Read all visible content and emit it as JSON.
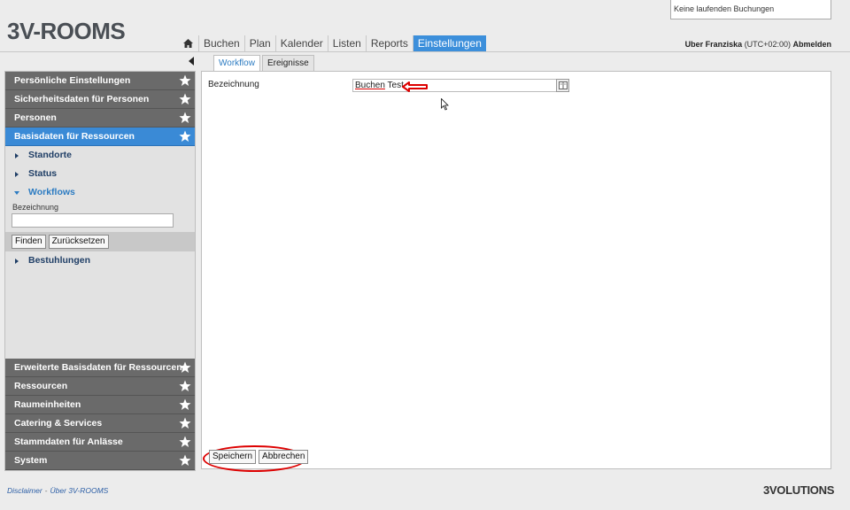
{
  "app": {
    "logo": "3V-ROOMS"
  },
  "notification": "Keine laufenden Buchungen",
  "topnav": {
    "home_icon": "home-icon",
    "tabs": [
      {
        "label": "Buchen"
      },
      {
        "label": "Plan"
      },
      {
        "label": "Kalender"
      },
      {
        "label": "Listen"
      },
      {
        "label": "Reports"
      },
      {
        "label": "Einstellungen",
        "active": true
      }
    ]
  },
  "user": {
    "name": "Uber Franziska",
    "tz": "(UTC+02:00)",
    "logout": "Abmelden"
  },
  "sidebar": {
    "sections_top": [
      {
        "label": "Persönliche Einstellungen"
      },
      {
        "label": "Sicherheitsdaten für Personen"
      },
      {
        "label": "Personen"
      },
      {
        "label": "Basisdaten für Ressourcen",
        "active": true
      }
    ],
    "subitems": [
      {
        "label": "Standorte"
      },
      {
        "label": "Status"
      },
      {
        "label": "Workflows",
        "open": true
      }
    ],
    "filter": {
      "label": "Bezeichnung",
      "value": "",
      "find": "Finden",
      "reset": "Zurücksetzen"
    },
    "subitem_after": {
      "label": "Bestuhlungen"
    },
    "sections_bottom": [
      {
        "label": "Erweiterte Basisdaten für Ressourcen"
      },
      {
        "label": "Ressourcen"
      },
      {
        "label": "Raumeinheiten"
      },
      {
        "label": "Catering & Services"
      },
      {
        "label": "Stammdaten für Anlässe"
      },
      {
        "label": "System"
      }
    ]
  },
  "main": {
    "tabs": [
      {
        "label": "Workflow",
        "active": true
      },
      {
        "label": "Ereignisse"
      }
    ],
    "field": {
      "label": "Bezeichnung",
      "value_part1": "Buchen",
      "value_part2": " Test"
    },
    "save": "Speichern",
    "cancel": "Abbrechen"
  },
  "footer": {
    "disclaimer": "Disclaimer",
    "about": "Über 3V-ROOMS",
    "brand": "3VOLUTIONS"
  },
  "colors": {
    "accent": "#3a8ad6",
    "section": "#6a6a6a",
    "annotation": "#dd0000"
  }
}
